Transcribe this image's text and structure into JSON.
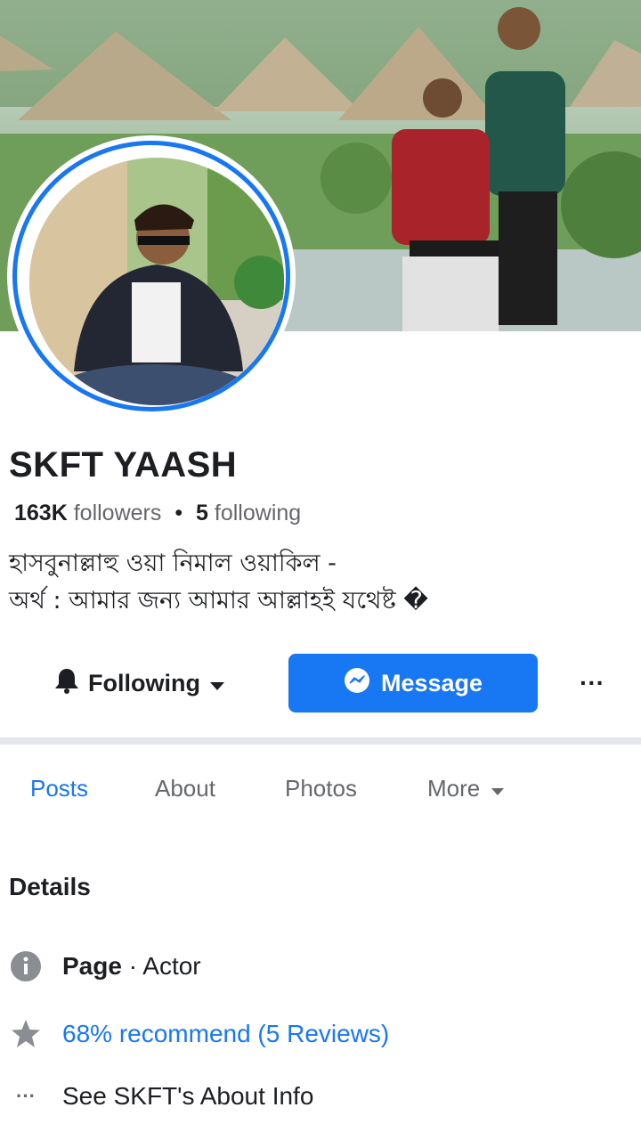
{
  "profile": {
    "name": "SKFT YAASH",
    "followers_count": "163K",
    "followers_label": "followers",
    "separator": "•",
    "following_count": "5",
    "following_label": "following",
    "bio_line1": "হাসবুনাল্লাহু ওয়া নিমাল ওয়াকিল -",
    "bio_line2": "অর্থ : আমার জন্য আমার আল্লাহই যথেষ্ট �"
  },
  "actions": {
    "following_label": "Following",
    "message_label": "Message",
    "more_label": "···"
  },
  "tabs": [
    {
      "label": "Posts",
      "active": true
    },
    {
      "label": "About",
      "active": false
    },
    {
      "label": "Photos",
      "active": false
    },
    {
      "label": "More",
      "active": false
    }
  ],
  "details": {
    "title": "Details",
    "page_label": "Page",
    "page_category": " · Actor",
    "recommend_text": "68% recommend (5 Reviews)",
    "about_info_text": "See SKFT's About Info",
    "about_icon_text": "···"
  },
  "icons": {
    "bell": "bell-icon",
    "caret": "caret-down-icon",
    "messenger": "messenger-icon",
    "info": "info-icon",
    "star": "star-icon",
    "more": "more-dots-icon"
  },
  "colors": {
    "accent": "#1877f2",
    "text": "#1c1e21",
    "muted": "#65676b",
    "icon_gray": "#8a8d91"
  }
}
